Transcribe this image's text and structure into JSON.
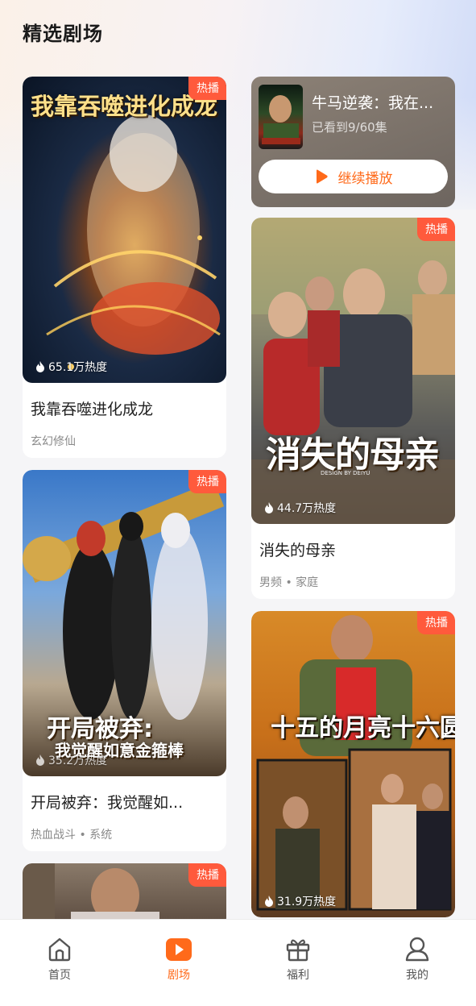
{
  "page": {
    "title": "精选剧场"
  },
  "badge_label": "热播",
  "continue_watching": {
    "title": "牛马逆袭：我在...",
    "progress": "已看到9/60集",
    "button_label": "继续播放"
  },
  "left_column": [
    {
      "poster_title": "我靠吞噬进化成龙",
      "heat": "65.1万热度",
      "title": "我靠吞噬进化成龙",
      "tags": "玄幻修仙"
    },
    {
      "poster_title_line1": "开局被弃:",
      "poster_title_line2": "我觉醒如意金箍棒",
      "heat": "35.2万热度",
      "title": "开局被弃：我觉醒如...",
      "tags": "热血战斗 • 系统"
    },
    {
      "heat": "",
      "title": "",
      "tags": ""
    }
  ],
  "right_column": [
    {
      "poster_title": "消失的母亲",
      "poster_credit": "DESIGN BY DEIYU",
      "heat": "44.7万热度",
      "title": "消失的母亲",
      "tags": "男频 • 家庭"
    },
    {
      "poster_title": "十五的月亮十六圆",
      "heat": "31.9万热度"
    }
  ],
  "tabs": [
    {
      "label": "首页",
      "icon": "home-icon",
      "active": false
    },
    {
      "label": "剧场",
      "icon": "play-icon",
      "active": true
    },
    {
      "label": "福利",
      "icon": "gift-icon",
      "active": false
    },
    {
      "label": "我的",
      "icon": "profile-icon",
      "active": false
    }
  ],
  "colors": {
    "accent": "#ff6a1a",
    "badge": "#ff5a3c"
  }
}
